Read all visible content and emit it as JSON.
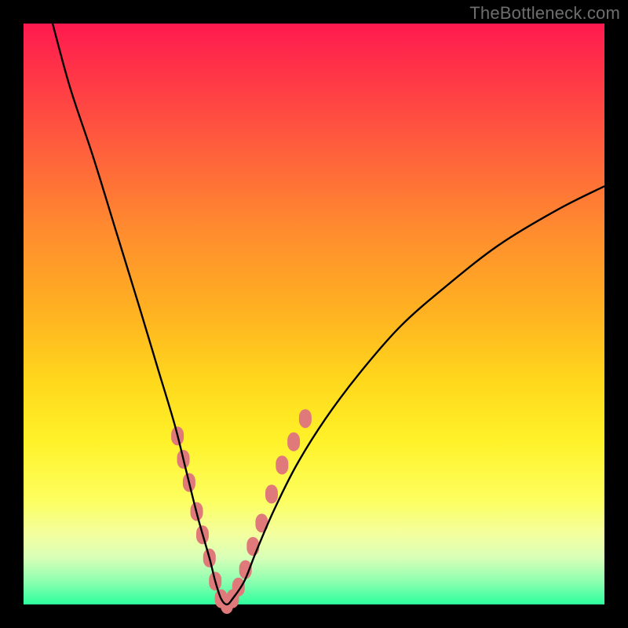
{
  "watermark": "TheBottleneck.com",
  "colors": {
    "background": "#000000",
    "gradient_top": "#ff1a4f",
    "gradient_bottom": "#2dff9d",
    "curve": "#000000",
    "marker": "#e07a7a"
  },
  "chart_data": {
    "type": "line",
    "title": "",
    "xlabel": "",
    "ylabel": "",
    "xlim": [
      0,
      100
    ],
    "ylim": [
      0,
      100
    ],
    "series": [
      {
        "name": "bottleneck-curve",
        "x": [
          5,
          8,
          12,
          16,
          20,
          23,
          26,
          28,
          30,
          32,
          33,
          34,
          35,
          36,
          38,
          40,
          43,
          47,
          52,
          58,
          65,
          73,
          82,
          92,
          100
        ],
        "y": [
          100,
          89,
          77,
          64,
          51,
          41,
          31,
          23,
          15,
          8,
          4,
          1,
          0,
          1,
          4,
          9,
          16,
          24,
          32,
          40,
          48,
          55,
          62,
          68,
          72
        ]
      }
    ],
    "markers": {
      "name": "highlight-points",
      "x": [
        26.5,
        27.5,
        28.5,
        29.8,
        30.8,
        32.0,
        33.0,
        34.0,
        35.0,
        36.0,
        37.0,
        38.2,
        39.5,
        41.0,
        42.7,
        44.5,
        46.5,
        48.5
      ],
      "y": [
        29,
        25,
        21,
        16,
        12,
        8,
        4,
        1,
        0,
        1,
        3,
        6,
        10,
        14,
        19,
        24,
        28,
        32
      ]
    }
  }
}
